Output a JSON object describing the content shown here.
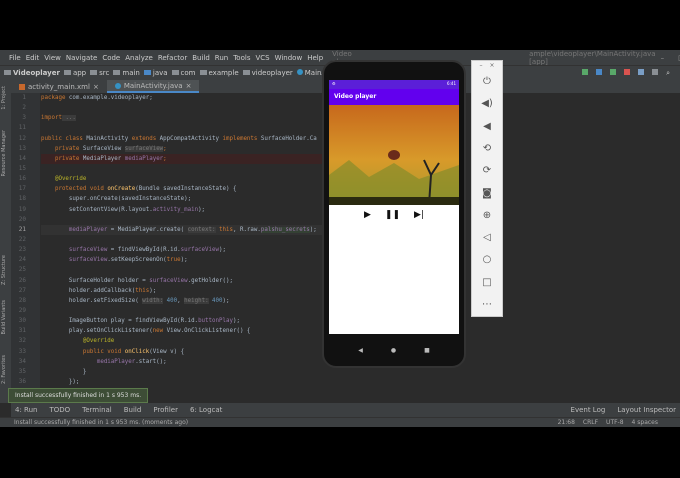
{
  "menu": {
    "items": [
      "File",
      "Edit",
      "View",
      "Navigate",
      "Code",
      "Analyze",
      "Refactor",
      "Build",
      "Run",
      "Tools",
      "VCS",
      "Window",
      "Help"
    ],
    "title": "Video player",
    "title_right": "ample\\videoplayer\\MainActivity.java [app]"
  },
  "breadcrumb": [
    "Videoplayer",
    "app",
    "src",
    "main",
    "java",
    "com",
    "example",
    "videoplayer",
    "MainActivity"
  ],
  "tabs": [
    "activity_main.xml",
    "MainActivity.java"
  ],
  "side_left": [
    "1: Project",
    "Resource Manager",
    "Z: Structure",
    "Build Variants",
    "2: Favorites"
  ],
  "gutter": [
    "1",
    "2",
    "3",
    "11",
    "12",
    "13",
    "14",
    "15",
    "16",
    "17",
    "18",
    "19",
    "20",
    "21",
    "22",
    "23",
    "24",
    "25",
    "26",
    "27",
    "28",
    "29",
    "30",
    "31",
    "32",
    "33",
    "34",
    "35",
    "36"
  ],
  "code": {
    "l1a": "package",
    "l1b": " com.example.videoplayer;",
    "l3a": "import",
    "l3b": " ...",
    "l12": [
      "public class ",
      "MainActivity ",
      "extends ",
      "AppCompatActivity ",
      "implements ",
      "SurfaceHolder.Ca"
    ],
    "l13": [
      "    private ",
      "SurfaceView ",
      "surfaceView",
      ";"
    ],
    "l14": [
      "    private ",
      "MediaPlayer ",
      "mediaPlayer",
      ";"
    ],
    "l16": "    @Override",
    "l17": [
      "    protected void ",
      "onCreate",
      "(Bundle savedInstanceState) {"
    ],
    "l18": "        super.onCreate(savedInstanceState);",
    "l19": [
      "        setContentView(R.layout.",
      "activity_main",
      ");"
    ],
    "l21": [
      "        mediaPlayer",
      " = MediaPlayer.create( ",
      "context:",
      " this",
      ", R.raw.",
      "palshu_secrets",
      ");"
    ],
    "l23": [
      "        surfaceView",
      " = findViewById(R.id.",
      "surfaceView",
      ");"
    ],
    "l24": [
      "        surfaceView",
      ".setKeepScreenOn(",
      "true",
      ");"
    ],
    "l26": [
      "        SurfaceHolder holder = ",
      "surfaceView",
      ".getHolder();"
    ],
    "l27": [
      "        holder.addCallback(",
      "this",
      ");"
    ],
    "l28": [
      "        holder.setFixedSize( ",
      "width:",
      " 400",
      ", ",
      "height:",
      " 400",
      ");"
    ],
    "l30": [
      "        ImageButton play = findViewById(R.id.",
      "buttonPlay",
      ");"
    ],
    "l31": [
      "        play.setOnClickListener(",
      "new ",
      "View.OnClickListener() {"
    ],
    "l32": "            @Override",
    "l33": [
      "            public void ",
      "onClick",
      "(View v) {"
    ],
    "l34": [
      "                mediaPlayer",
      ".start();"
    ],
    "l35": "            }",
    "l36": "        });"
  },
  "toast": "Install successfully finished in 1 s 953 ms.",
  "bottom_tools": [
    "4: Run",
    "TODO",
    "Terminal",
    "Build",
    "Profiler",
    "6: Logcat",
    "Event Log",
    "Layout Inspector"
  ],
  "status": {
    "message": "Install successfully finished in 1 s 953 ms. (moments ago)",
    "position": "21:68",
    "line_sep": "CRLF",
    "encoding": "UTF-8",
    "indent": "4 spaces"
  },
  "phone": {
    "time": "6:41",
    "app_title": "Video player"
  },
  "emulator": {
    "min": "–",
    "close": "×"
  }
}
